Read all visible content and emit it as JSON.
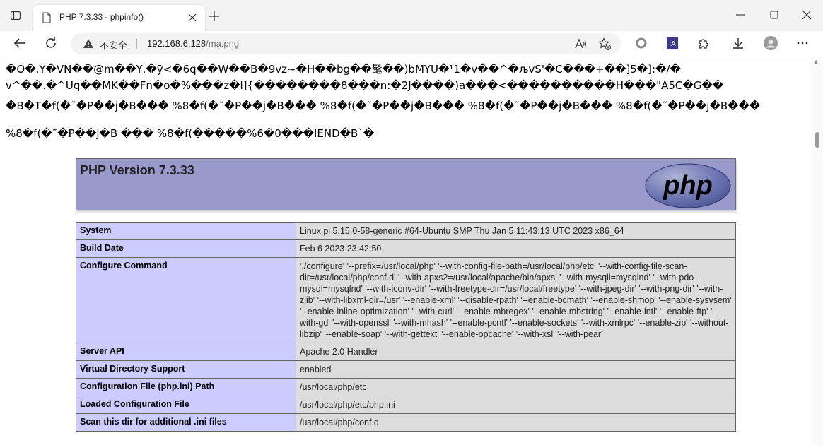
{
  "browser": {
    "tab_title": "PHP 7.3.33 - phpinfo()",
    "security_label": "不安全",
    "url_host": "192.168.6.128",
    "url_path": "/ma.png"
  },
  "page": {
    "garbage_lines": [
      "�O�.Y�VN��@m��Y,�ӯ<�6q��W��B�9vz~�H��bg��髦��)bMYU�¹1�v��^�љvS'�C���+��]5�]:�/�",
      "v^��.�^Uq��MK��Fn�o�%���z�l]{��������8���n:�2J����)a���<����������H���\"A5C�G��",
      "�B�T�f(�˜�P��j�B��� %8�f(�˜�P��j�B��� %8�f(�˜�P��j�B��� %8�f(�˜�P��j�B��� %8�f(�˜�P��j�B���",
      "%8�f(�˜�P��j�B ��� %8�f(�����%6�0���IEND�B`�"
    ],
    "php_version_title": "PHP Version 7.3.33",
    "logo_text": "php",
    "info_rows": [
      {
        "label": "System",
        "value": "Linux pi 5.15.0-58-generic #64-Ubuntu SMP Thu Jan 5 11:43:13 UTC 2023 x86_64"
      },
      {
        "label": "Build Date",
        "value": "Feb 6 2023 23:42:50"
      },
      {
        "label": "Configure Command",
        "value": "'./configure' '--prefix=/usr/local/php' '--with-config-file-path=/usr/local/php/etc' '--with-config-file-scan-dir=/usr/local/php/conf.d' '--with-apxs2=/usr/local/apache/bin/apxs' '--with-mysqli=mysqlnd' '--with-pdo-mysql=mysqlnd' '--with-iconv-dir' '--with-freetype-dir=/usr/local/freetype' '--with-jpeg-dir' '--with-png-dir' '--with-zlib' '--with-libxml-dir=/usr' '--enable-xml' '--disable-rpath' '--enable-bcmath' '--enable-shmop' '--enable-sysvsem' '--enable-inline-optimization' '--with-curl' '--enable-mbregex' '--enable-mbstring' '--enable-intl' '--enable-ftp' '--with-gd' '--with-openssl' '--with-mhash' '--enable-pcntl' '--enable-sockets' '--with-xmlrpc' '--enable-zip' '--without-libzip' '--enable-soap' '--with-gettext' '--enable-opcache' '--with-xsl' '--with-pear'"
      },
      {
        "label": "Server API",
        "value": "Apache 2.0 Handler"
      },
      {
        "label": "Virtual Directory Support",
        "value": "enabled"
      },
      {
        "label": "Configuration File (php.ini) Path",
        "value": "/usr/local/php/etc"
      },
      {
        "label": "Loaded Configuration File",
        "value": "/usr/local/php/etc/php.ini"
      },
      {
        "label": "Scan this dir for additional .ini files",
        "value": "/usr/local/php/conf.d"
      }
    ]
  }
}
